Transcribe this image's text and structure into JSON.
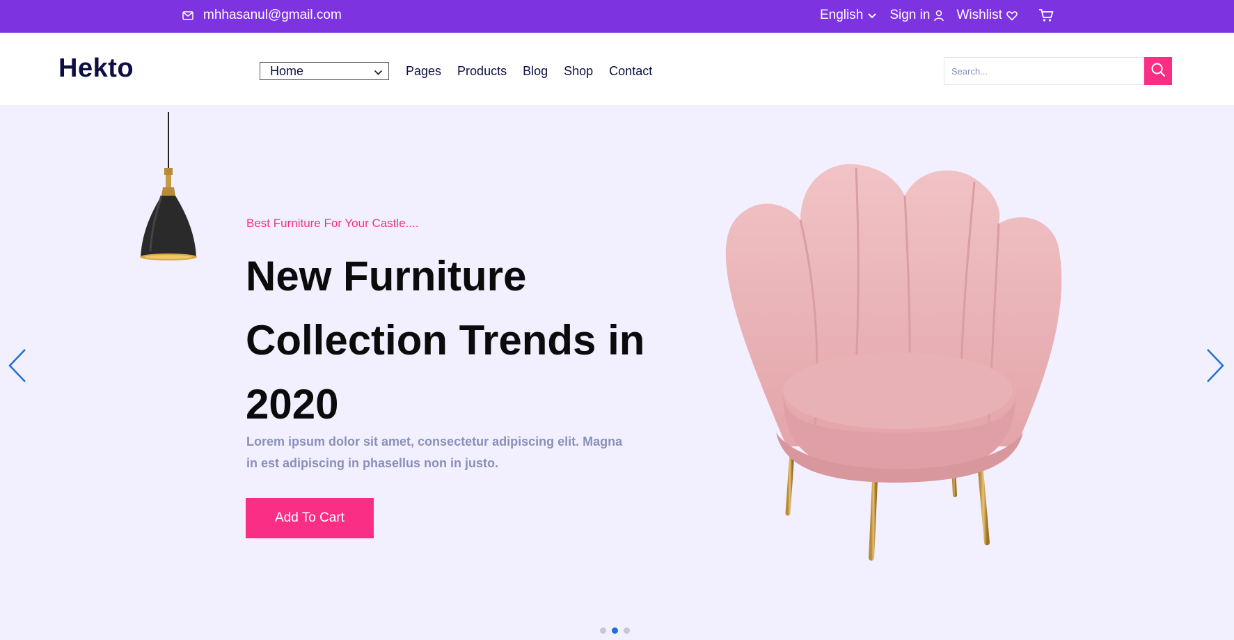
{
  "topbar": {
    "email": "mhhasanul@gmail.com",
    "language": "English",
    "signin": "Sign in",
    "wishlist": "Wishlist",
    "cart_icon": "cart-icon"
  },
  "header": {
    "logo": "Hekto",
    "nav": {
      "home_select": "Home",
      "links": [
        "Pages",
        "Products",
        "Blog",
        "Shop",
        "Contact"
      ]
    },
    "search": {
      "placeholder": "Search..."
    }
  },
  "hero": {
    "subtitle": "Best Furniture For Your Castle....",
    "headline": "New Furniture Collection Trends in 2020",
    "description": "Lorem ipsum dolor sit amet, consectetur adipiscing elit. Magna in est adipiscing in phasellus non in justo.",
    "cta": "Add To Cart",
    "slides": {
      "count": 3,
      "active": 2
    }
  },
  "colors": {
    "topbar": "#7E33E0",
    "accent": "#FB2E86",
    "hero_bg": "#F2F0FF",
    "nav_text": "#0D0E43",
    "slider_arrows": "#1E6FD9"
  }
}
